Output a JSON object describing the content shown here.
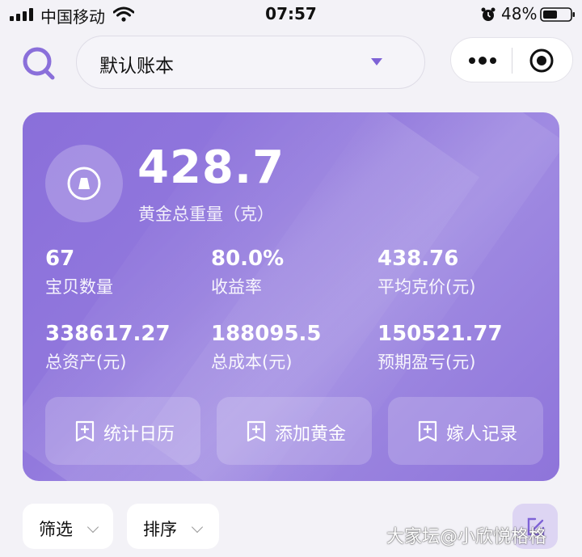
{
  "status_bar": {
    "carrier": "中国移动",
    "time": "07:57",
    "battery_percent": "48%"
  },
  "header": {
    "account_book": "默认账本"
  },
  "summary": {
    "total_weight": "428.7",
    "total_weight_label": "黄金总重量（克）",
    "stats": [
      {
        "value": "67",
        "label": "宝贝数量"
      },
      {
        "value": "80.0%",
        "label": "收益率"
      },
      {
        "value": "438.76",
        "label": "平均克价(元)"
      },
      {
        "value": "338617.27",
        "label": "总资产(元)"
      },
      {
        "value": "188095.5",
        "label": "总成本(元)"
      },
      {
        "value": "150521.77",
        "label": "预期盈亏(元)"
      }
    ],
    "actions": [
      {
        "label": "统计日历"
      },
      {
        "label": "添加黄金"
      },
      {
        "label": "嫁人记录"
      }
    ]
  },
  "filters": {
    "filter_label": "筛选",
    "sort_label": "排序"
  },
  "watermark": "大家坛@小欣悦格格",
  "colors": {
    "accent": "#8a6fda",
    "background": "#f3f2f7"
  }
}
